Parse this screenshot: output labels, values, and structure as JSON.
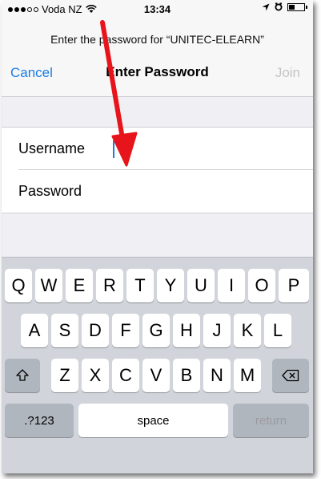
{
  "status_bar": {
    "carrier": "Voda NZ",
    "time": "13:34"
  },
  "nav": {
    "prompt": "Enter the password for “UNITEC-ELEARN”",
    "cancel_label": "Cancel",
    "title": "Enter Password",
    "join_label": "Join"
  },
  "form": {
    "username_label": "Username",
    "password_label": "Password"
  },
  "keyboard": {
    "row1": [
      "Q",
      "W",
      "E",
      "R",
      "T",
      "Y",
      "U",
      "I",
      "O",
      "P"
    ],
    "row2": [
      "A",
      "S",
      "D",
      "F",
      "G",
      "H",
      "J",
      "K",
      "L"
    ],
    "row3": [
      "Z",
      "X",
      "C",
      "V",
      "B",
      "N",
      "M"
    ],
    "numbers_label": ".?123",
    "space_label": "space",
    "return_label": "return",
    "shift_icon": "shift-icon",
    "delete_icon": "delete-icon"
  },
  "colors": {
    "accent": "#1a7de3",
    "annotation_arrow": "#e8141b"
  }
}
